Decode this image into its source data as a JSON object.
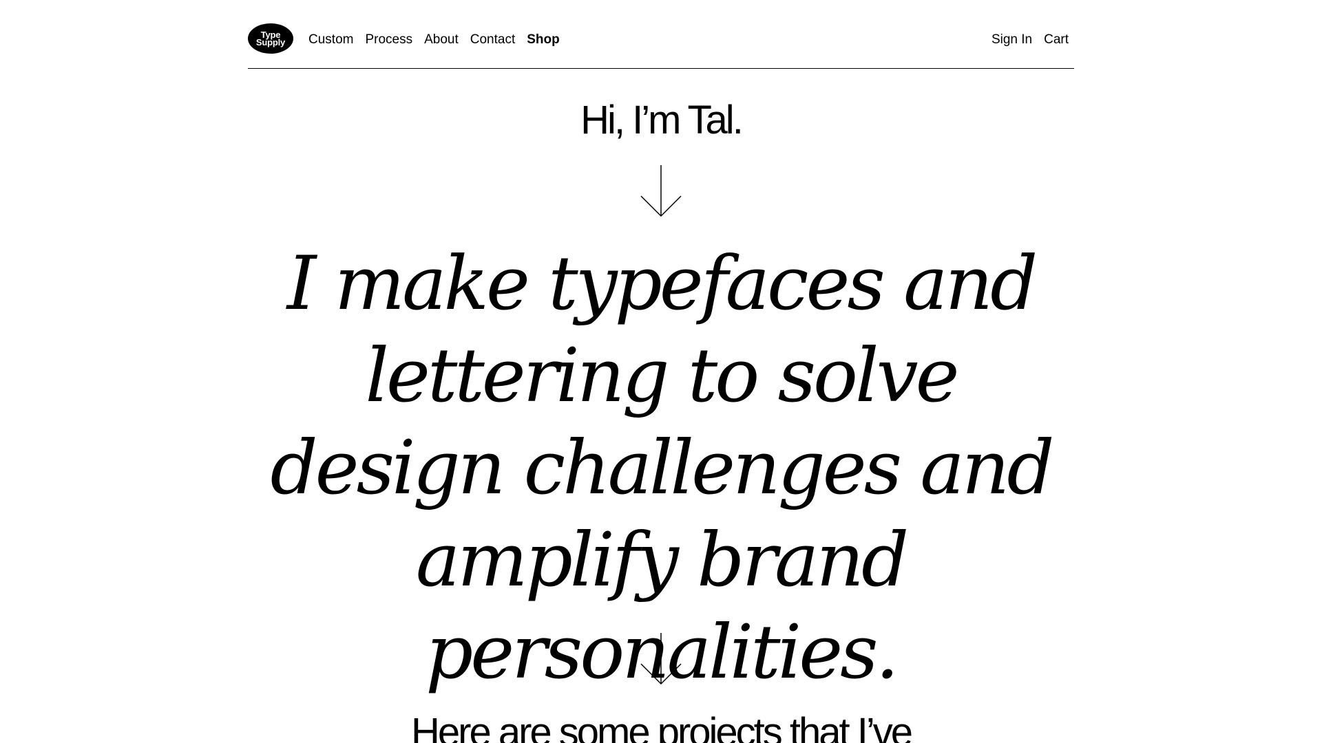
{
  "header": {
    "logo": {
      "line1": "Type",
      "line2": "Supply"
    },
    "nav_left": [
      {
        "label": "Custom"
      },
      {
        "label": "Process"
      },
      {
        "label": "About"
      },
      {
        "label": "Contact"
      },
      {
        "label": "Shop"
      }
    ],
    "nav_right": [
      {
        "label": "Sign In"
      },
      {
        "label": "Cart"
      }
    ]
  },
  "hero": {
    "greeting": "Hi, I’m Tal.",
    "statement": "I make typefaces and lettering to solve design challenges and amplify brand personalities.",
    "projects_intro": "Here are some projects that I’ve"
  },
  "icons": {
    "arrow_1": "arrow-down-icon",
    "arrow_2": "arrow-down-icon"
  },
  "colors": {
    "background": "#ffffff",
    "text": "#000000"
  }
}
